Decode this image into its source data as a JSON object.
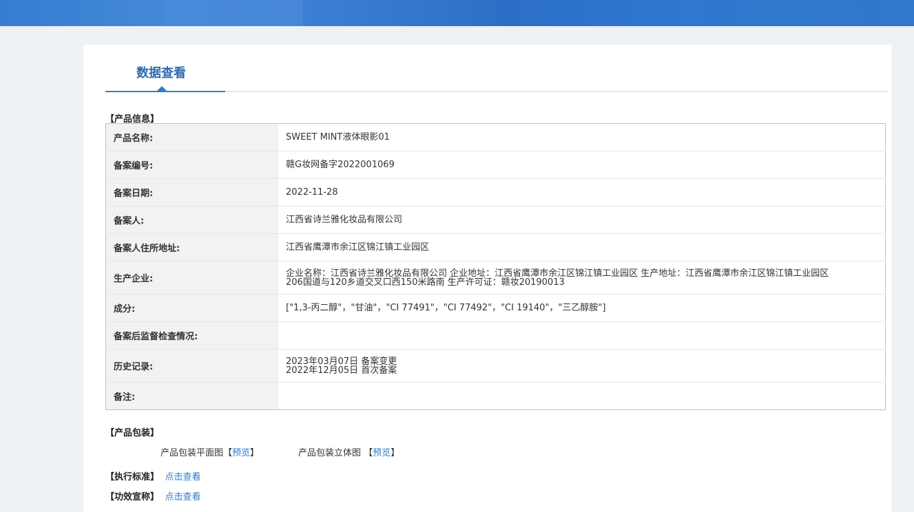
{
  "tab": {
    "title": "数据查看"
  },
  "sections": {
    "product_info": "【产品信息】",
    "packaging": "【产品包装】",
    "standard": "【执行标准】",
    "efficacy": "【功效宣称】"
  },
  "product_rows": [
    {
      "label": "产品名称:",
      "value": "SWEET MINT液体眼影01"
    },
    {
      "label": "备案编号:",
      "value": "赣G妆网备字2022001069"
    },
    {
      "label": "备案日期:",
      "value": "2022-11-28"
    },
    {
      "label": "备案人:",
      "value": "江西省诗兰雅化妆品有限公司"
    },
    {
      "label": "备案人住所地址:",
      "value": "江西省鹰潭市余江区锦江镇工业园区"
    },
    {
      "label": "生产企业:",
      "value_line1": "企业名称：江西省诗兰雅化妆品有限公司 企业地址：江西省鹰潭市余江区锦江镇工业园区 生产地址：江西省鹰潭市余江区锦江镇工业园区",
      "value_line2": "206国道与120乡道交叉口西150米路南 生产许可证：赣妆20190013"
    },
    {
      "label": "成分:",
      "value": "[\"1,3-丙二醇\"，\"甘油\"，\"CI 77491\"，\"CI 77492\"，\"CI 19140\"，\"三乙醇胺\"]"
    },
    {
      "label": "备案后监督检查情况:",
      "value": ""
    },
    {
      "label": "历史记录:",
      "value_line1": "2023年03月07日 备案变更",
      "value_line2": "2022年12月05日 首次备案"
    },
    {
      "label": "备注:",
      "value": ""
    }
  ],
  "packaging": {
    "flat_label": "产品包装平面图",
    "solid_label": "产品包装立体图",
    "bracket_open": "【",
    "bracket_close": "】",
    "preview": "预览"
  },
  "links": {
    "view": "点击查看"
  },
  "colors": {
    "accent": "#2f7fd1",
    "title": "#2c6ab0",
    "link": "#2e7bc9",
    "header": "#2f78cf"
  }
}
